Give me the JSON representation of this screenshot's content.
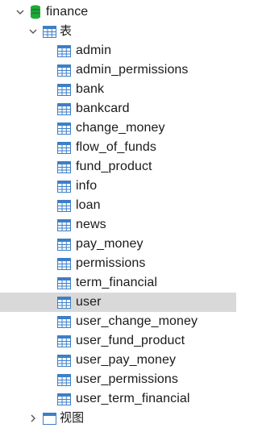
{
  "tree": {
    "database": {
      "name": "finance",
      "icon": "database-icon",
      "icon_color": "#1faa3a"
    },
    "tables_folder": {
      "label": "表",
      "icon": "table-folder-icon"
    },
    "tables": [
      "admin",
      "admin_permissions",
      "bank",
      "bankcard",
      "change_money",
      "flow_of_funds",
      "fund_product",
      "info",
      "loan",
      "news",
      "pay_money",
      "permissions",
      "term_financial",
      "user",
      "user_change_money",
      "user_fund_product",
      "user_pay_money",
      "user_permissions",
      "user_term_financial"
    ],
    "selected_table": "user",
    "views_folder": {
      "label": "视图",
      "icon": "view-folder-icon"
    },
    "colors": {
      "table_icon": "#3d7fc6",
      "selected_bg": "#d9d9d9"
    }
  }
}
